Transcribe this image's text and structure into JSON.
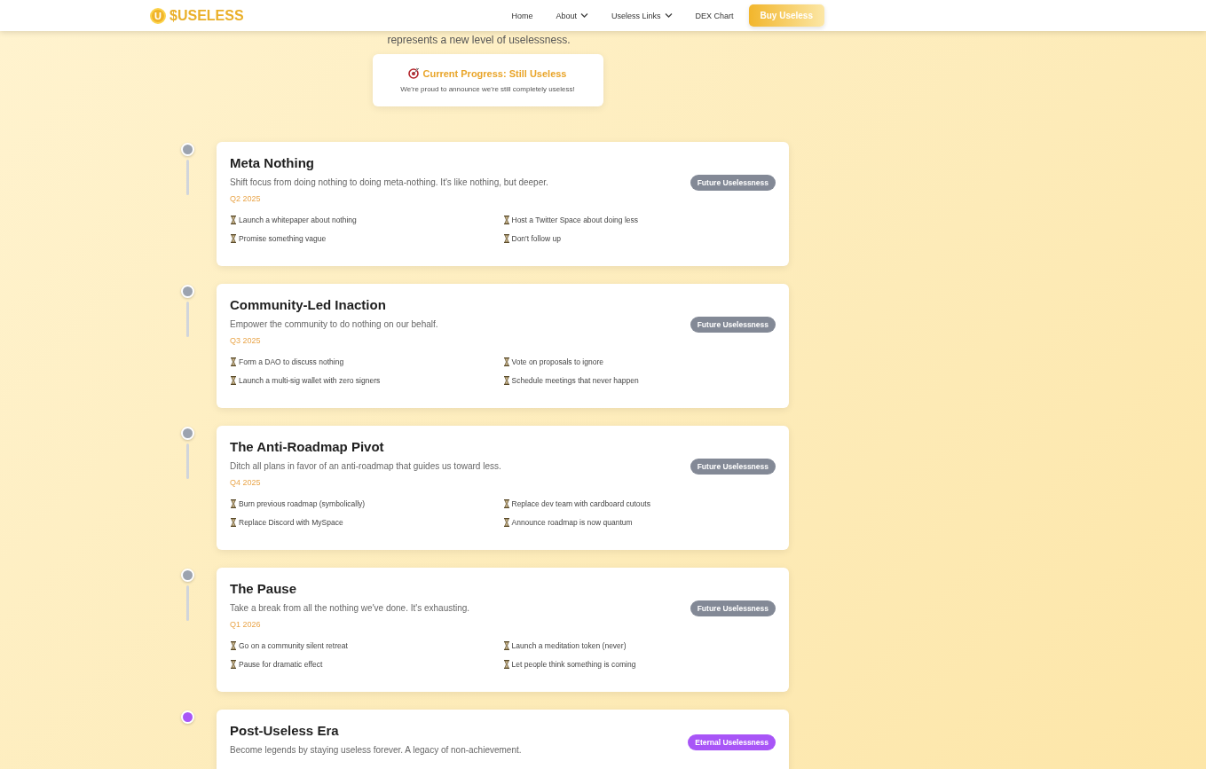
{
  "header": {
    "logo_letter": "U",
    "brand": "$USELESS",
    "nav": [
      {
        "label": "Home",
        "dropdown": false
      },
      {
        "label": "About",
        "dropdown": true
      },
      {
        "label": "Useless Links",
        "dropdown": true
      },
      {
        "label": "DEX Chart",
        "dropdown": false
      }
    ],
    "cta": "Buy Useless"
  },
  "intro": "represents a new level of uselessness.",
  "progress": {
    "title": "Current Progress: Still Useless",
    "text": "We're proud to announce we're still completely useless!"
  },
  "phases": [
    {
      "title": "Meta Nothing",
      "description": "Shift focus from doing nothing to doing meta-nothing. It's like nothing, but deeper.",
      "date": "Q2 2025",
      "kind": "future",
      "badge": "Future Uselessness",
      "items": [
        "Launch a whitepaper about nothing",
        "Host a Twitter Space about doing less",
        "Promise something vague",
        "Don't follow up"
      ]
    },
    {
      "title": "Community-Led Inaction",
      "description": "Empower the community to do nothing on our behalf.",
      "date": "Q3 2025",
      "kind": "future",
      "badge": "Future Uselessness",
      "items": [
        "Form a DAO to discuss nothing",
        "Vote on proposals to ignore",
        "Launch a multi-sig wallet with zero signers",
        "Schedule meetings that never happen"
      ]
    },
    {
      "title": "The Anti-Roadmap Pivot",
      "description": "Ditch all plans in favor of an anti-roadmap that guides us toward less.",
      "date": "Q4 2025",
      "kind": "future",
      "badge": "Future Uselessness",
      "items": [
        "Burn previous roadmap (symbolically)",
        "Replace dev team with cardboard cutouts",
        "Replace Discord with MySpace",
        "Announce roadmap is now quantum"
      ]
    },
    {
      "title": "The Pause",
      "description": "Take a break from all the nothing we've done. It's exhausting.",
      "date": "Q1 2026",
      "kind": "future",
      "badge": "Future Uselessness",
      "items": [
        "Go on a community silent retreat",
        "Launch a meditation token (never)",
        "Pause for dramatic effect",
        "Let people think something is coming"
      ]
    },
    {
      "title": "Post-Useless Era",
      "description": "Become legends by staying useless forever. A legacy of non-achievement.",
      "kind": "eternal",
      "badge": "Eternal Uselessness"
    }
  ]
}
